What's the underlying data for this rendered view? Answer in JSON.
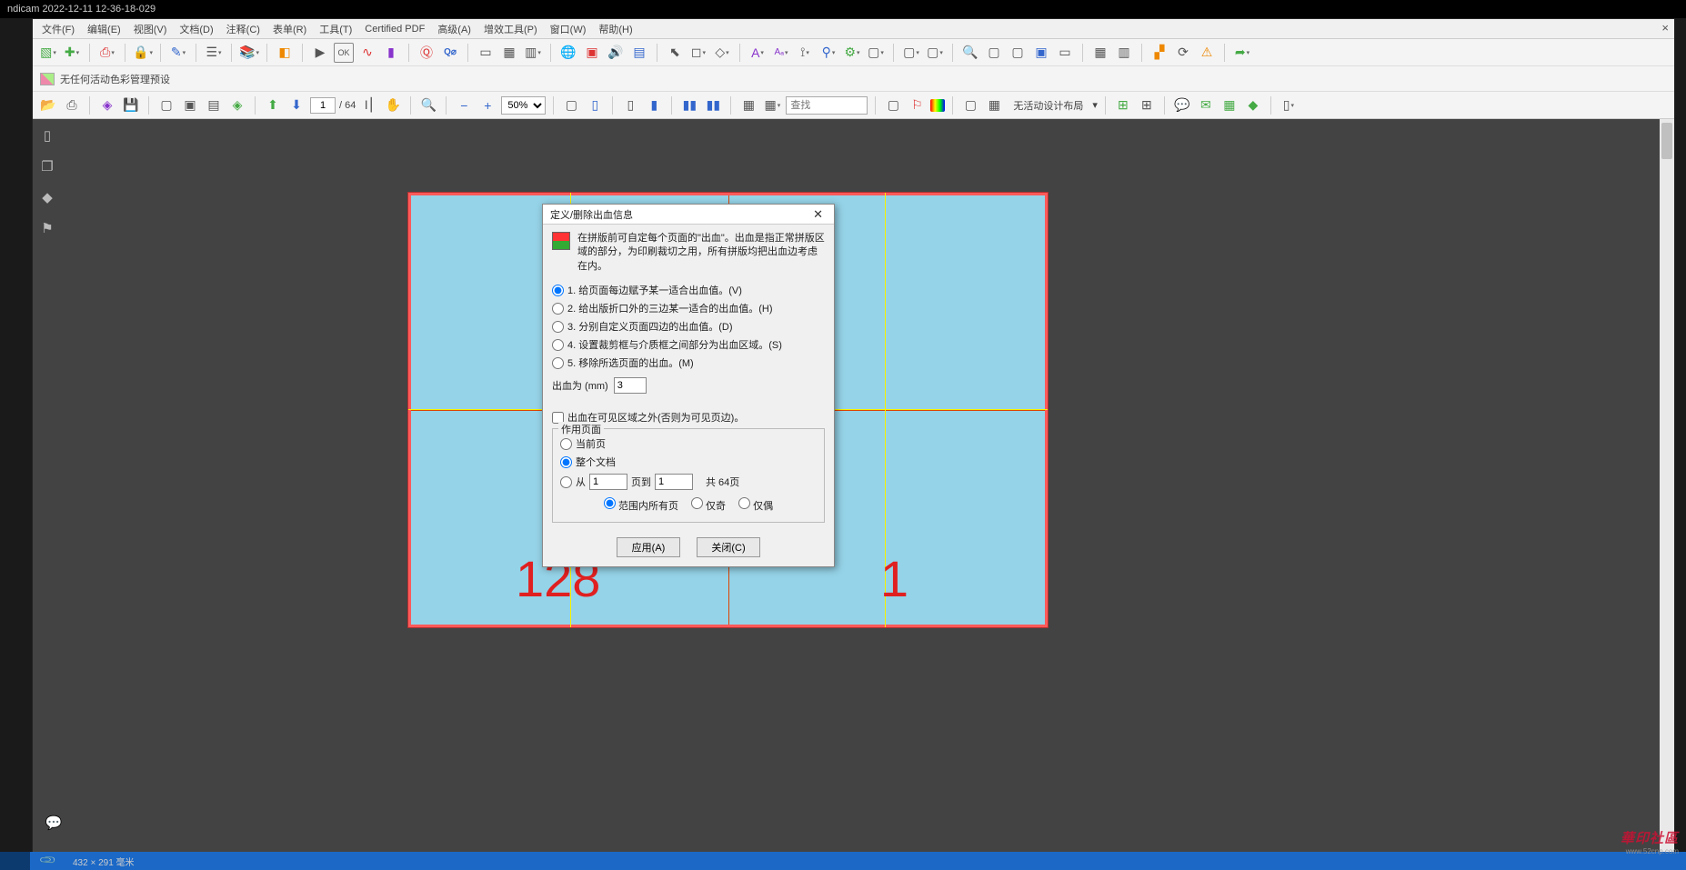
{
  "outer_title": "ndicam 2022-12-11 12-36-18-029",
  "menus": [
    "文件(F)",
    "编辑(E)",
    "视图(V)",
    "文档(D)",
    "注释(C)",
    "表单(R)",
    "工具(T)",
    "Certified PDF",
    "高级(A)",
    "增效工具(P)",
    "窗口(W)",
    "帮助(H)"
  ],
  "preset_label": "无任何活动色彩管理预设",
  "nav": {
    "page_current": "1",
    "page_total": "/ 64",
    "zoom": "50%",
    "search_placeholder": "查找",
    "layout_label": "无活动设计布局"
  },
  "page_numbers": {
    "left": "128",
    "right": "1"
  },
  "dialog": {
    "title": "定义/删除出血信息",
    "desc": "在拼版前可自定每个页面的\"出血\"。出血是指正常拼版区域的部分，为印刷裁切之用，所有拼版均把出血边考虑在内。",
    "opt1": "1. 给页面每边赋予某一适合出血值。(V)",
    "opt2": "2. 给出版折口外的三边某一适合的出血值。(H)",
    "opt3": "3. 分别自定义页面四边的出血值。(D)",
    "opt4": "4. 设置裁剪框与介质框之间部分为出血区域。(S)",
    "opt5": "5. 移除所选页面的出血。(M)",
    "bleed_label": "出血为 (mm)",
    "bleed_value": "3",
    "outside_check": "出血在可见区域之外(否则为可见页边)。",
    "scope_legend": "作用页面",
    "scope_current": "当前页",
    "scope_all": "整个文档",
    "scope_from": "从",
    "scope_from_val": "1",
    "scope_to": "页到",
    "scope_to_val": "1",
    "scope_total": "共 64页",
    "range_all": "范围内所有页",
    "range_odd": "仅奇",
    "range_even": "仅偶",
    "btn_apply": "应用(A)",
    "btn_close": "关闭(C)"
  },
  "status_dim": "432 × 291 毫米",
  "watermark": "華印社區",
  "watermark_sub": "www.52cnp.com"
}
